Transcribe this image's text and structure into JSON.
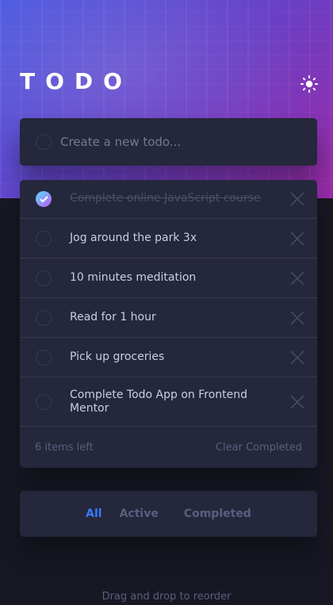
{
  "app": {
    "title": "TODO",
    "theme_icon": "sun-icon"
  },
  "new_todo": {
    "placeholder": "Create a new todo..."
  },
  "todos": [
    {
      "text": "Complete online JavaScript course",
      "completed": true
    },
    {
      "text": "Jog around the park 3x",
      "completed": false
    },
    {
      "text": "10 minutes meditation",
      "completed": false
    },
    {
      "text": "Read for 1 hour",
      "completed": false
    },
    {
      "text": "Pick up groceries",
      "completed": false
    },
    {
      "text": "Complete Todo App on Frontend Mentor",
      "completed": false
    }
  ],
  "footer": {
    "items_left": "6 items left",
    "clear_label": "Clear Completed"
  },
  "filters": {
    "all": "All",
    "active": "Active",
    "completed": "Completed",
    "selected": "All"
  },
  "hint": "Drag and drop to reorder",
  "colors": {
    "accent": "#3a7bfd",
    "card": "#25273c",
    "background": "#181824",
    "check_gradient": [
      "#57ddff",
      "#c058f3"
    ]
  }
}
